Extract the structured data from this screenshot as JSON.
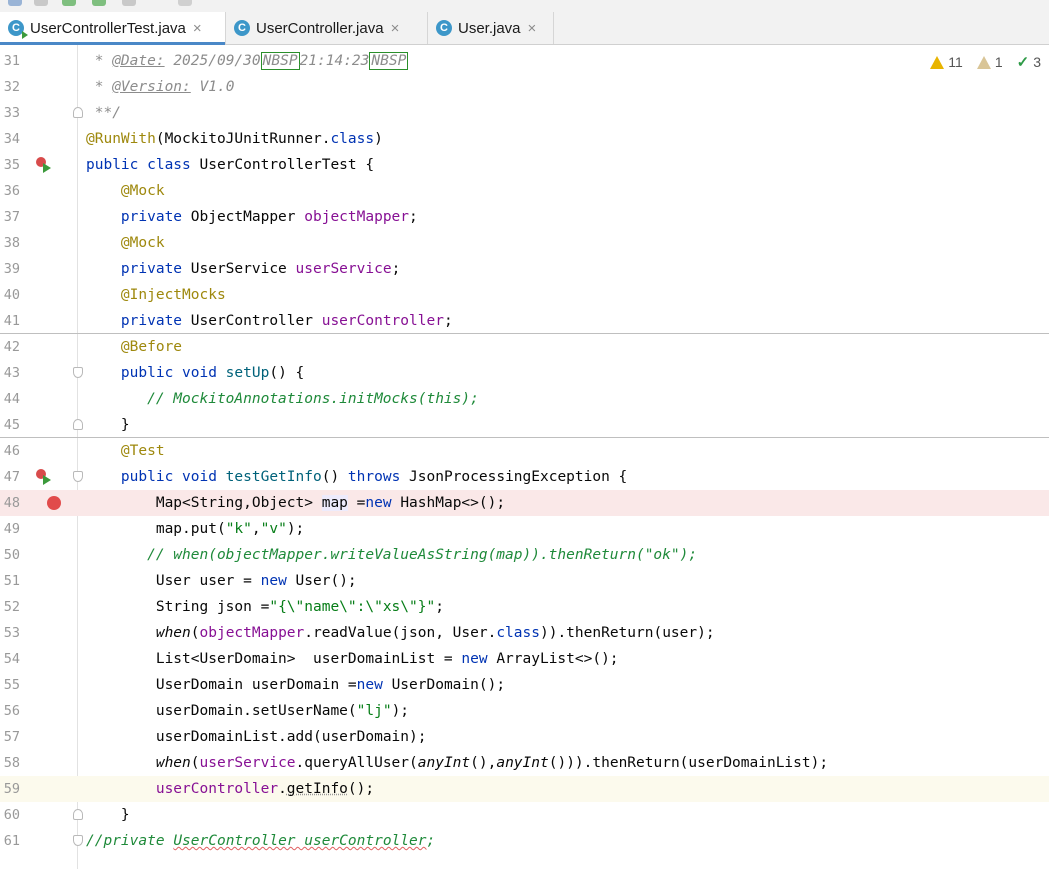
{
  "tabs": [
    {
      "label": "UserControllerTest.java",
      "icon": "c-test-class-icon",
      "close": "×"
    },
    {
      "label": "UserController.java",
      "icon": "c-class-icon",
      "close": "×"
    },
    {
      "label": "User.java",
      "icon": "c-class-icon",
      "close": "×"
    }
  ],
  "inspections": {
    "warnings": "11",
    "weak_warnings": "1",
    "typos": "3"
  },
  "line_numbers": [
    "31",
    "32",
    "33",
    "34",
    "35",
    "36",
    "37",
    "38",
    "39",
    "40",
    "41",
    "42",
    "43",
    "44",
    "45",
    "46",
    "47",
    "48",
    "49",
    "50",
    "51",
    "52",
    "53",
    "54",
    "55",
    "56",
    "57",
    "58",
    "59",
    "60",
    "61"
  ],
  "code": {
    "l31_star": " * ",
    "l31_tag": "@Date:",
    "l31_val1": " 2025/09/30",
    "l31_nbsp1": "NBSP",
    "l31_val2": "21:14:23",
    "l31_nbsp2": "NBSP",
    "l32_star": " * ",
    "l32_tag": "@Version:",
    "l32_val": " V1.0",
    "l33": " **/",
    "l34_ann": "@RunWith",
    "l34_a": "(MockitoJUnitRunner.",
    "l34_kw": "class",
    "l34_b": ")",
    "l35_kw": "public class",
    "l35_rest": " UserControllerTest {",
    "l36": "@Mock",
    "l37_kw": "private",
    "l37_type": " ObjectMapper ",
    "l37_fld": "objectMapper",
    "l37_end": ";",
    "l38": "@Mock",
    "l39_kw": "private",
    "l39_type": " UserService ",
    "l39_fld": "userService",
    "l39_end": ";",
    "l40": "@InjectMocks",
    "l41_kw": "private",
    "l41_type": " UserController ",
    "l41_fld": "userController",
    "l41_end": ";",
    "l42": "@Before",
    "l43_kw": "public void",
    "l43_m": " setUp",
    "l43_rest": "() {",
    "l44": "// MockitoAnnotations.initMocks(this);",
    "l45": "}",
    "l46": "@Test",
    "l47_kw": "public void",
    "l47_m": " testGetInfo",
    "l47_a": "() ",
    "l47_kw2": "throws",
    "l47_rest": " JsonProcessingException {",
    "l48_a": "Map<String,Object> ",
    "l48_var": "map",
    "l48_b": " =",
    "l48_kw": "new",
    "l48_c": " HashMap<>();",
    "l49_a": "map.put(",
    "l49_s1": "\"k\"",
    "l49_b": ",",
    "l49_s2": "\"v\"",
    "l49_c": ");",
    "l50": "// when(objectMapper.writeValueAsString(map)).thenReturn(\"ok\");",
    "l51_a": "User user = ",
    "l51_kw": "new",
    "l51_b": " User();",
    "l52_a": "String json =",
    "l52_s": "\"{\\\"name\\\":\\\"xs\\\"}\"",
    "l52_b": ";",
    "l53_when": "when",
    "l53_a": "(",
    "l53_fld": "objectMapper",
    "l53_b": ".readValue(json, User.",
    "l53_kw": "class",
    "l53_c": ")).thenReturn(user);",
    "l54_a": "List<UserDomain>  userDomainList = ",
    "l54_kw": "new",
    "l54_b": " ArrayList<>();",
    "l55_a": "UserDomain userDomain =",
    "l55_kw": "new",
    "l55_b": " UserDomain();",
    "l56_a": "userDomain.setUserName(",
    "l56_s": "\"lj\"",
    "l56_b": ");",
    "l57": "userDomainList.add(userDomain);",
    "l58_when": "when",
    "l58_a": "(",
    "l58_fld": "userService",
    "l58_b": ".queryAllUser(",
    "l58_i1": "anyInt",
    "l58_c": "(),",
    "l58_i2": "anyInt",
    "l58_d": "())).thenReturn(userDomainList);",
    "l59_fld": "userController",
    "l59_a": ".",
    "l59_m": "getInfo",
    "l59_b": "();",
    "l60": "}",
    "l61_a": "//private ",
    "l61_b": "UserController userController",
    "l61_c": ";"
  },
  "colors": {
    "keyword": "#0033b3",
    "annotation": "#9e880d",
    "field": "#871094",
    "string": "#067d17",
    "comment": "#8c8c8c",
    "tab_underline": "#4a88c7",
    "error_line_bg": "#fae8e8",
    "breakpoint": "#e14b4b"
  }
}
